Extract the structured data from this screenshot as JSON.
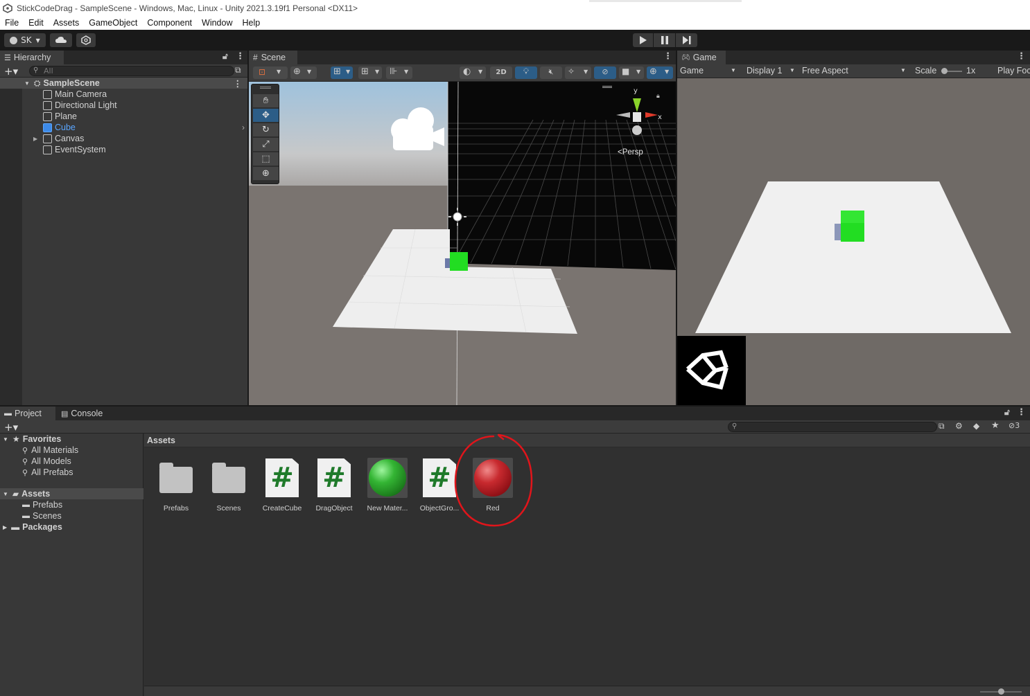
{
  "window": {
    "title": "StickCodeDrag - SampleScene - Windows, Mac, Linux - Unity 2021.3.19f1 Personal <DX11>"
  },
  "menu": [
    "File",
    "Edit",
    "Assets",
    "GameObject",
    "Component",
    "Window",
    "Help"
  ],
  "toolbar": {
    "account_label": "SK"
  },
  "hierarchy": {
    "tab_label": "Hierarchy",
    "search_placeholder": "All",
    "scene_name": "SampleScene",
    "items": [
      {
        "label": "Main Camera",
        "selected": false
      },
      {
        "label": "Directional Light",
        "selected": false
      },
      {
        "label": "Plane",
        "selected": false
      },
      {
        "label": "Cube",
        "selected": true
      },
      {
        "label": "Canvas",
        "selected": false
      },
      {
        "label": "EventSystem",
        "selected": false
      }
    ]
  },
  "scene": {
    "tab_label": "Scene",
    "mode_2d_label": "2D",
    "persp_label": "Persp",
    "gizmo_y": "y",
    "gizmo_x": "x"
  },
  "game": {
    "tab_label": "Game",
    "view_select": "Game",
    "display_select": "Display 1",
    "aspect_select": "Free Aspect",
    "scale_label": "Scale",
    "scale_value": "1x",
    "play_focus_label": "Play Foc"
  },
  "project": {
    "tab_label": "Project",
    "console_tab_label": "Console",
    "hidden_count": "3",
    "favorites_label": "Favorites",
    "favorites": [
      "All Materials",
      "All Models",
      "All Prefabs"
    ],
    "assets_label": "Assets",
    "asset_folders": [
      "Prefabs",
      "Scenes"
    ],
    "packages_label": "Packages",
    "breadcrumb": "Assets",
    "assets": [
      {
        "label": "Prefabs",
        "kind": "folder"
      },
      {
        "label": "Scenes",
        "kind": "folder"
      },
      {
        "label": "CreateCube",
        "kind": "script"
      },
      {
        "label": "DragObject",
        "kind": "script"
      },
      {
        "label": "New Mater...",
        "kind": "material",
        "color": "#2f9e2f"
      },
      {
        "label": "ObjectGro...",
        "kind": "script"
      },
      {
        "label": "Red",
        "kind": "material",
        "color": "#b3161c"
      }
    ],
    "script_glyph": "#"
  },
  "colors": {
    "accent_selection": "#2c5d87",
    "cube_green": "#22dd22",
    "annotation_red": "#e0151b"
  }
}
